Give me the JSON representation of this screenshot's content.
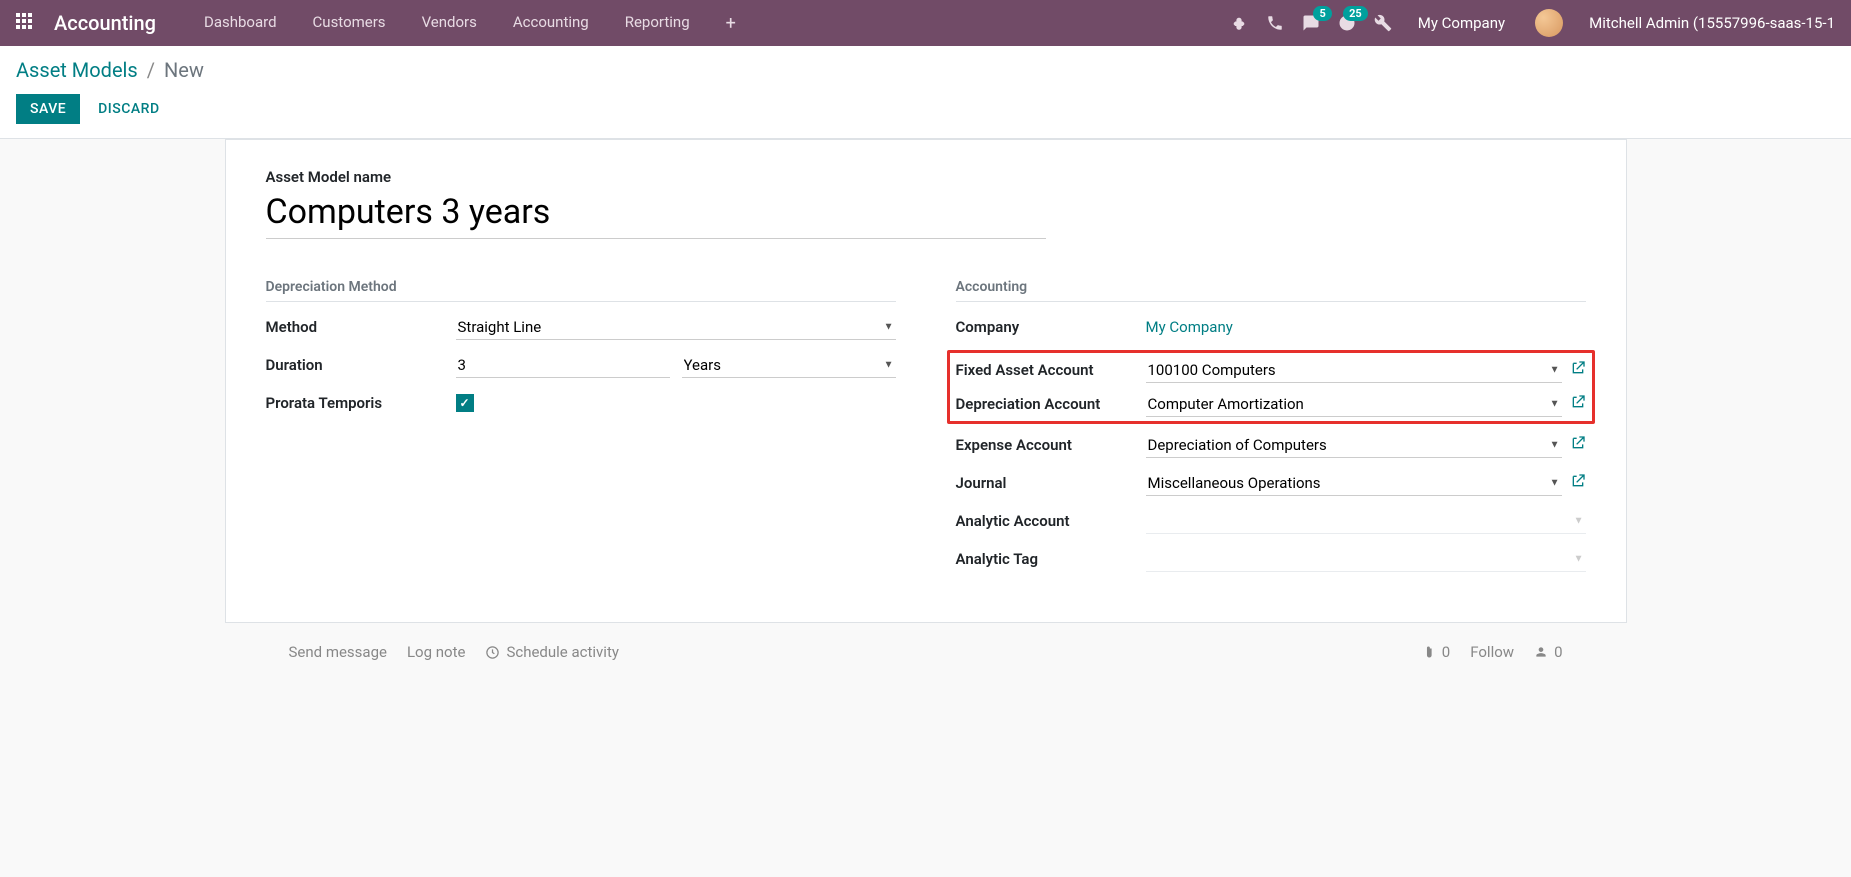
{
  "navbar": {
    "app_name": "Accounting",
    "menu": [
      "Dashboard",
      "Customers",
      "Vendors",
      "Accounting",
      "Reporting"
    ],
    "messages_badge": "5",
    "activities_badge": "25",
    "company": "My Company",
    "user": "Mitchell Admin (15557996-saas-15-1"
  },
  "breadcrumb": {
    "parent": "Asset Models",
    "current": "New"
  },
  "actions": {
    "save": "SAVE",
    "discard": "DISCARD"
  },
  "form": {
    "title_label": "Asset Model name",
    "title_value": "Computers 3 years",
    "left_group": {
      "title": "Depreciation Method",
      "method_label": "Method",
      "method_value": "Straight Line",
      "duration_label": "Duration",
      "duration_value": "3",
      "duration_unit": "Years",
      "prorata_label": "Prorata Temporis",
      "prorata_checked": true
    },
    "right_group": {
      "title": "Accounting",
      "company_label": "Company",
      "company_value": "My Company",
      "fixed_asset_label": "Fixed Asset Account",
      "fixed_asset_value": "100100 Computers",
      "depr_account_label": "Depreciation Account",
      "depr_account_value": "Computer Amortization",
      "expense_label": "Expense Account",
      "expense_value": "Depreciation of Computers",
      "journal_label": "Journal",
      "journal_value": "Miscellaneous Operations",
      "analytic_acc_label": "Analytic Account",
      "analytic_acc_value": "",
      "analytic_tag_label": "Analytic Tag",
      "analytic_tag_value": ""
    }
  },
  "chatter": {
    "send_message": "Send message",
    "log_note": "Log note",
    "schedule": "Schedule activity",
    "attachments": "0",
    "follow": "Follow",
    "followers": "0"
  }
}
